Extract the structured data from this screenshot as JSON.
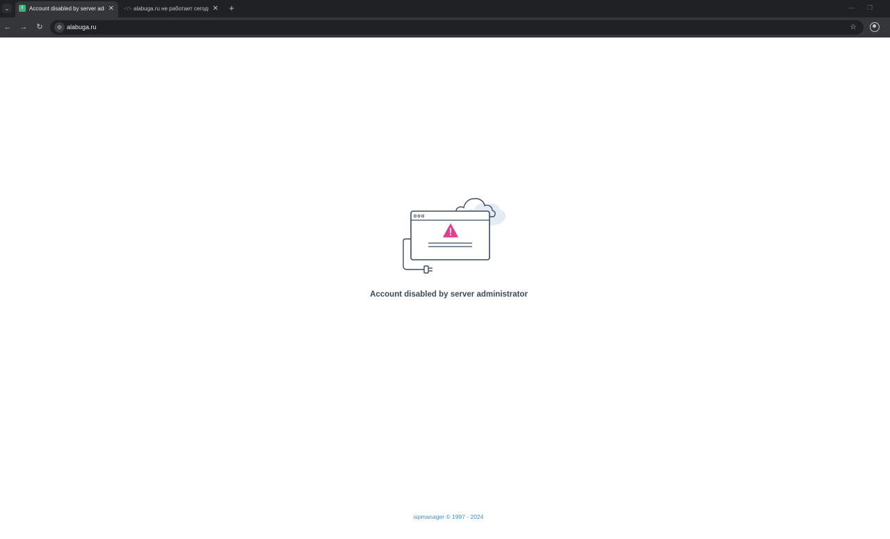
{
  "browser": {
    "tabs": [
      {
        "title": "Account disabled by server adm",
        "active": true,
        "favicon": "ispmanager-icon"
      },
      {
        "title": "alabuga.ru не работает сегодн",
        "active": false,
        "favicon": "code-icon"
      }
    ],
    "address": "alabuga.ru"
  },
  "page": {
    "message": "Account disabled by server administrator",
    "footer": "ispmanager © 1997 - 2024",
    "colors": {
      "text": "#3b4a5e",
      "accent_warning": "#e03e8f",
      "footer_link": "#3d8ed0"
    }
  }
}
